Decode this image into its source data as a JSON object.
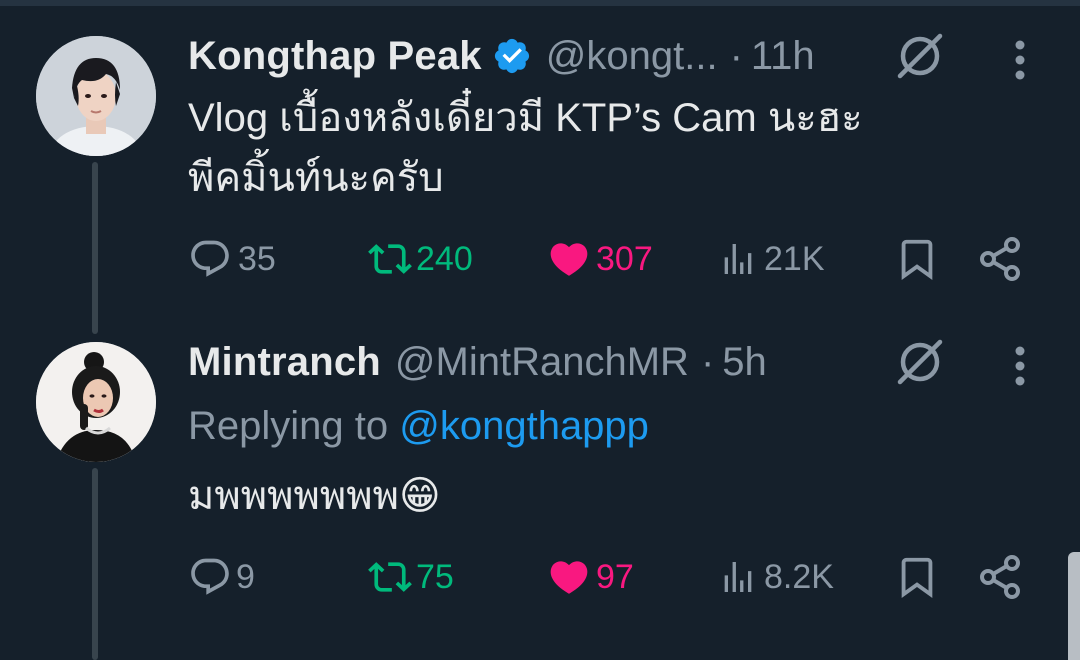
{
  "tweets": [
    {
      "display_name": "Kongthap Peak",
      "verified": true,
      "handle": "@kongt...",
      "separator": "·",
      "time": "11h",
      "text_line1": "Vlog เบื้องหลังเดี๋ยวมี KTP’s Cam นะฮะ",
      "text_line2": "พีคมิ้นท์นะครับ",
      "replies": "35",
      "retweets": "240",
      "likes": "307",
      "views": "21K"
    },
    {
      "display_name": "Mintranch",
      "verified": false,
      "handle": "@MintRanchMR",
      "separator": "·",
      "time": "5h",
      "replying_prefix": "Replying to ",
      "replying_to": "@kongthappp",
      "text": "มพพพพพพพ",
      "emoji": "😁",
      "replies": "9",
      "retweets": "75",
      "likes": "97",
      "views": "8.2K"
    }
  ],
  "colors": {
    "background": "#15202b",
    "text": "#e7e9ea",
    "muted": "#8b98a5",
    "link": "#1d9bf0",
    "retweet": "#00ba7c",
    "like": "#f91880",
    "verified": "#1d9bf0"
  },
  "icons": [
    "reply-icon",
    "retweet-icon",
    "heart-icon",
    "views-icon",
    "bookmark-icon",
    "share-icon",
    "grok-icon",
    "more-icon",
    "verified-badge-icon"
  ]
}
